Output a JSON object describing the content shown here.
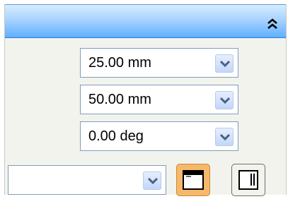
{
  "header": {
    "collapse_icon": "double-chevron-up-icon"
  },
  "fields": [
    {
      "value": "25.00 mm"
    },
    {
      "value": "50.00 mm"
    },
    {
      "value": "0.00 deg"
    }
  ],
  "style_select": {
    "value": ""
  },
  "layout_buttons": [
    {
      "icon": "window-with-title-bar-icon",
      "active": true
    },
    {
      "icon": "window-right-panel-icon",
      "active": false
    }
  ],
  "colors": {
    "header": "#5fb0ff",
    "active_button": "#f6b86a"
  }
}
